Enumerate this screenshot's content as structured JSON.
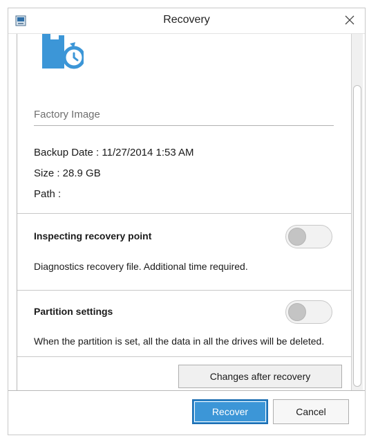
{
  "window": {
    "title": "Recovery"
  },
  "image": {
    "name": "Factory Image",
    "backup_date": "Backup Date : 11/27/2014 1:53 AM",
    "size": "Size : 28.9 GB",
    "path": "Path :"
  },
  "sections": [
    {
      "title": "Inspecting recovery point",
      "description": "Diagnostics recovery file. Additional time required.",
      "toggle_on": false
    },
    {
      "title": "Partition settings",
      "description": "When the partition is set, all the data in all the drives will be deleted.",
      "toggle_on": false
    }
  ],
  "buttons": {
    "changes": "Changes after recovery",
    "recover": "Recover",
    "cancel": "Cancel"
  },
  "colors": {
    "accent": "#3c96d7",
    "accent_border": "#1e6fb3",
    "toggle_off": "#c4c4c4"
  },
  "icons": {
    "app": "recovery-app-icon",
    "close": "close-icon",
    "hero": "drive-restore-icon"
  }
}
